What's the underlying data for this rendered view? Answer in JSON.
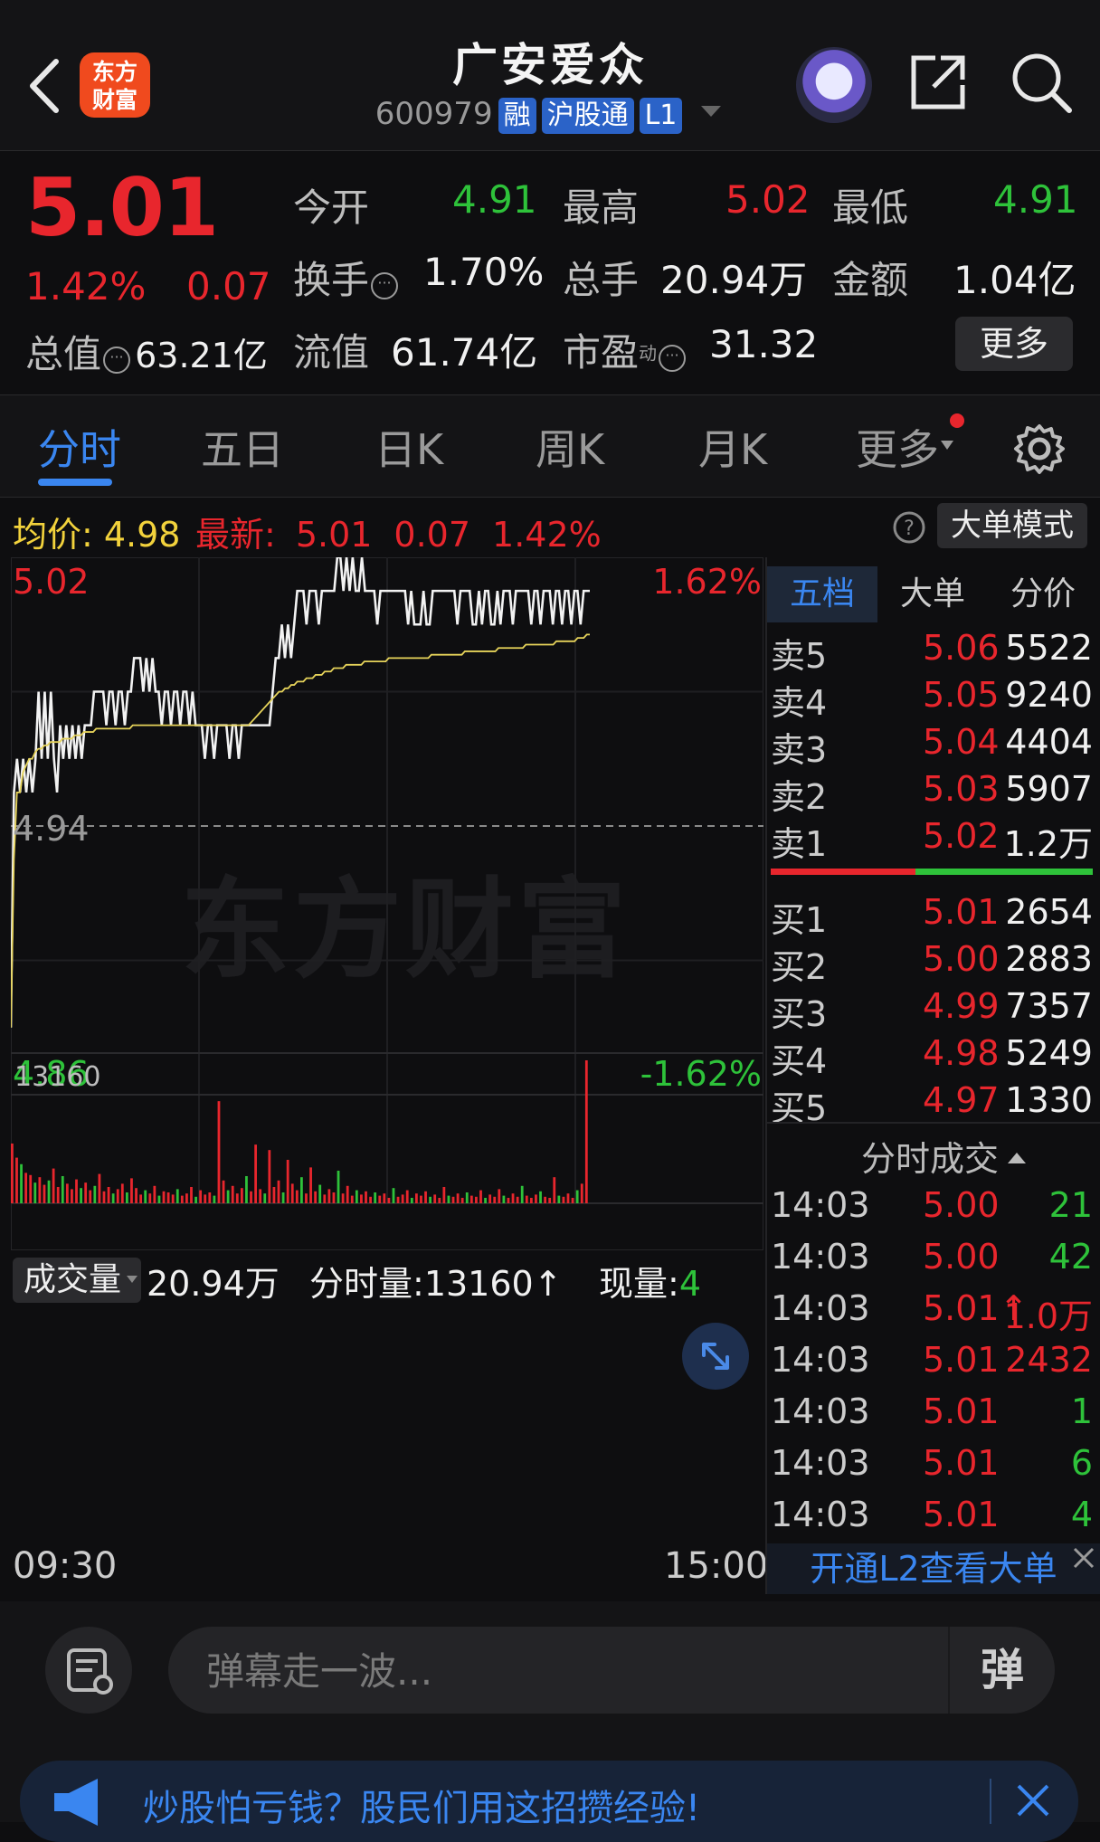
{
  "header": {
    "title": "广安爱众",
    "code": "600979",
    "tags": [
      "融",
      "沪股通",
      "L1"
    ],
    "logo_line1": "东方",
    "logo_line2": "财富"
  },
  "quote": {
    "price": "5.01",
    "change_pct": "1.42%",
    "change": "0.07",
    "total_value_label": "总值",
    "total_value": "63.21亿",
    "open_label": "今开",
    "open": "4.91",
    "high_label": "最高",
    "high": "5.02",
    "low_label": "最低",
    "low": "4.91",
    "turnover_label": "换手",
    "turnover": "1.70%",
    "volume_label": "总手",
    "volume": "20.94万",
    "amount_label": "金额",
    "amount": "1.04亿",
    "float_label": "流值",
    "float_value": "61.74亿",
    "pe_label": "市盈",
    "pe_sup": "动",
    "pe": "31.32",
    "more_label": "更多"
  },
  "tabs": [
    "分时",
    "五日",
    "日K",
    "周K",
    "月K",
    "更多"
  ],
  "info_bar": {
    "avg_label": "均价:",
    "avg": "4.98",
    "latest_label": "最新:",
    "latest": "5.01",
    "change": "0.07",
    "pct": "1.42%",
    "big_mode": "大单模式"
  },
  "chart_data": {
    "type": "line",
    "ylim": [
      4.86,
      5.02
    ],
    "y_left_labels": [
      "5.02",
      "4.94",
      "4.86"
    ],
    "y_right_labels": [
      "1.62%",
      "-1.62%"
    ],
    "x_labels": [
      "09:30",
      "15:00"
    ],
    "series": [
      {
        "values": [
          4.88,
          4.95,
          4.96,
          4.95,
          4.96,
          4.95,
          4.96,
          4.95,
          4.96,
          4.98,
          4.96,
          4.98,
          4.96,
          4.98,
          4.96,
          4.95,
          4.97,
          4.96,
          4.97,
          4.96,
          4.97,
          4.96,
          4.97,
          4.96,
          4.97,
          4.97,
          4.97,
          4.98,
          4.98,
          4.98,
          4.98,
          4.97,
          4.98,
          4.98,
          4.97,
          4.98,
          4.98,
          4.97,
          4.98,
          4.98,
          4.99,
          4.99,
          4.99,
          4.98,
          4.99,
          4.98,
          4.99,
          4.98,
          4.98,
          4.97,
          4.98,
          4.98,
          4.97,
          4.98,
          4.98,
          4.97,
          4.98,
          4.98,
          4.97,
          4.98,
          4.97,
          4.97,
          4.97,
          4.96,
          4.97,
          4.97,
          4.96,
          4.97,
          4.97,
          4.97,
          4.97,
          4.96,
          4.97,
          4.97,
          4.96,
          4.97,
          4.97,
          4.97,
          4.97,
          4.97,
          4.97,
          4.97,
          4.97,
          4.97,
          4.97,
          4.98,
          4.99,
          4.99,
          5.0,
          4.99,
          5.0,
          4.99,
          5.0,
          5.01,
          5.01,
          5.01,
          5.0,
          5.01,
          5.01,
          5.01,
          5.0,
          5.01,
          5.01,
          5.01,
          5.01,
          5.01,
          5.02,
          5.02,
          5.01,
          5.02,
          5.01,
          5.02,
          5.01,
          5.01,
          5.02,
          5.01,
          5.01,
          5.01,
          5.01,
          5.0,
          5.01,
          5.01,
          5.01,
          5.01,
          5.01,
          5.01,
          5.01,
          5.01,
          5.01,
          5.0,
          5.01,
          5.0,
          5.0,
          5.0,
          5.01,
          5.0,
          5.0,
          5.01,
          5.01,
          5.01,
          5.01,
          5.01,
          5.01,
          5.01,
          5.01,
          5.0,
          5.01,
          5.01,
          5.01,
          5.01,
          5.0,
          5.0,
          5.01,
          5.0,
          5.01,
          5.01,
          5.0,
          5.0,
          5.01,
          5.0,
          5.01,
          5.01,
          5.01,
          5.0,
          5.01,
          5.01,
          5.01,
          5.01,
          5.01,
          5.0,
          5.01,
          5.01,
          5.0,
          5.01,
          5.01,
          5.01,
          5.0,
          5.01,
          5.01,
          5.0,
          5.01,
          5.01,
          5.0,
          5.01,
          5.01,
          5.0,
          5.01,
          5.01,
          5.01
        ]
      },
      {
        "values": [
          4.88,
          4.93,
          4.95,
          4.95,
          4.956,
          4.958,
          4.96,
          4.96,
          4.962,
          4.963,
          4.963,
          4.964,
          4.964,
          4.965,
          4.965,
          4.965,
          4.965,
          4.966,
          4.966,
          4.966,
          4.966,
          4.967,
          4.967,
          4.967,
          4.968,
          4.968,
          4.968,
          4.968,
          4.969,
          4.969,
          4.969,
          4.969,
          4.969,
          4.969,
          4.969,
          4.969,
          4.969,
          4.969,
          4.969,
          4.969,
          4.97,
          4.97,
          4.97,
          4.97,
          4.97,
          4.97,
          4.97,
          4.97,
          4.97,
          4.97,
          4.97,
          4.97,
          4.97,
          4.97,
          4.97,
          4.97,
          4.97,
          4.97,
          4.97,
          4.97,
          4.97,
          4.97,
          4.97,
          4.97,
          4.97,
          4.97,
          4.97,
          4.97,
          4.97,
          4.97,
          4.97,
          4.97,
          4.97,
          4.97,
          4.97,
          4.97,
          4.97,
          4.97,
          4.97,
          4.971,
          4.972,
          4.973,
          4.974,
          4.975,
          4.976,
          4.977,
          4.978,
          4.979,
          4.98,
          4.98,
          4.981,
          4.981,
          4.982,
          4.982,
          4.983,
          4.983,
          4.983,
          4.984,
          4.984,
          4.984,
          4.985,
          4.985,
          4.985,
          4.986,
          4.986,
          4.986,
          4.987,
          4.987,
          4.987,
          4.987,
          4.988,
          4.988,
          4.988,
          4.988,
          4.988,
          4.988,
          4.989,
          4.989,
          4.989,
          4.989,
          4.989,
          4.989,
          4.989,
          4.989,
          4.99,
          4.99,
          4.99,
          4.99,
          4.99,
          4.99,
          4.99,
          4.99,
          4.99,
          4.99,
          4.99,
          4.99,
          4.99,
          4.99,
          4.991,
          4.991,
          4.991,
          4.991,
          4.991,
          4.991,
          4.991,
          4.991,
          4.991,
          4.991,
          4.991,
          4.992,
          4.992,
          4.992,
          4.992,
          4.992,
          4.992,
          4.992,
          4.992,
          4.992,
          4.992,
          4.992,
          4.993,
          4.993,
          4.993,
          4.993,
          4.993,
          4.993,
          4.993,
          4.993,
          4.993,
          4.994,
          4.994,
          4.994,
          4.994,
          4.994,
          4.994,
          4.994,
          4.994,
          4.994,
          4.994,
          4.995,
          4.995,
          4.995,
          4.995,
          4.995,
          4.995,
          4.995,
          4.996,
          4.996,
          4.996,
          4.997,
          4.997
        ]
      }
    ],
    "volume_max_label": "13160",
    "volume": [
      {
        "v": 5500,
        "c": "red"
      },
      {
        "v": 4200,
        "c": "red"
      },
      {
        "v": 3600,
        "c": "green"
      },
      {
        "v": 2800,
        "c": "red"
      },
      {
        "v": 2600,
        "c": "red"
      },
      {
        "v": 1900,
        "c": "green"
      },
      {
        "v": 2400,
        "c": "red"
      },
      {
        "v": 1700,
        "c": "red"
      },
      {
        "v": 2100,
        "c": "green"
      },
      {
        "v": 3200,
        "c": "red"
      },
      {
        "v": 1500,
        "c": "red"
      },
      {
        "v": 2500,
        "c": "green"
      },
      {
        "v": 1800,
        "c": "red"
      },
      {
        "v": 1300,
        "c": "red"
      },
      {
        "v": 2200,
        "c": "red"
      },
      {
        "v": 1400,
        "c": "green"
      },
      {
        "v": 1900,
        "c": "red"
      },
      {
        "v": 1200,
        "c": "red"
      },
      {
        "v": 1600,
        "c": "green"
      },
      {
        "v": 2700,
        "c": "red"
      },
      {
        "v": 1100,
        "c": "red"
      },
      {
        "v": 1500,
        "c": "red"
      },
      {
        "v": 900,
        "c": "green"
      },
      {
        "v": 1300,
        "c": "red"
      },
      {
        "v": 1800,
        "c": "red"
      },
      {
        "v": 1000,
        "c": "green"
      },
      {
        "v": 2300,
        "c": "red"
      },
      {
        "v": 1400,
        "c": "red"
      },
      {
        "v": 800,
        "c": "red"
      },
      {
        "v": 1200,
        "c": "green"
      },
      {
        "v": 900,
        "c": "red"
      },
      {
        "v": 1600,
        "c": "red"
      },
      {
        "v": 700,
        "c": "green"
      },
      {
        "v": 1100,
        "c": "red"
      },
      {
        "v": 1000,
        "c": "red"
      },
      {
        "v": 800,
        "c": "red"
      },
      {
        "v": 1300,
        "c": "green"
      },
      {
        "v": 700,
        "c": "red"
      },
      {
        "v": 900,
        "c": "red"
      },
      {
        "v": 1500,
        "c": "red"
      },
      {
        "v": 600,
        "c": "green"
      },
      {
        "v": 1200,
        "c": "red"
      },
      {
        "v": 800,
        "c": "red"
      },
      {
        "v": 1000,
        "c": "red"
      },
      {
        "v": 700,
        "c": "green"
      },
      {
        "v": 9400,
        "c": "red"
      },
      {
        "v": 2100,
        "c": "red"
      },
      {
        "v": 1200,
        "c": "green"
      },
      {
        "v": 1600,
        "c": "red"
      },
      {
        "v": 900,
        "c": "red"
      },
      {
        "v": 1400,
        "c": "red"
      },
      {
        "v": 2500,
        "c": "green"
      },
      {
        "v": 1100,
        "c": "red"
      },
      {
        "v": 5400,
        "c": "red"
      },
      {
        "v": 1300,
        "c": "red"
      },
      {
        "v": 900,
        "c": "green"
      },
      {
        "v": 4900,
        "c": "red"
      },
      {
        "v": 1500,
        "c": "red"
      },
      {
        "v": 2100,
        "c": "red"
      },
      {
        "v": 1000,
        "c": "green"
      },
      {
        "v": 4000,
        "c": "red"
      },
      {
        "v": 1800,
        "c": "red"
      },
      {
        "v": 1200,
        "c": "red"
      },
      {
        "v": 2400,
        "c": "green"
      },
      {
        "v": 900,
        "c": "red"
      },
      {
        "v": 3300,
        "c": "red"
      },
      {
        "v": 1100,
        "c": "red"
      },
      {
        "v": 1700,
        "c": "green"
      },
      {
        "v": 800,
        "c": "red"
      },
      {
        "v": 1300,
        "c": "red"
      },
      {
        "v": 1000,
        "c": "red"
      },
      {
        "v": 3000,
        "c": "green"
      },
      {
        "v": 900,
        "c": "red"
      },
      {
        "v": 1600,
        "c": "red"
      },
      {
        "v": 700,
        "c": "red"
      },
      {
        "v": 1200,
        "c": "green"
      },
      {
        "v": 800,
        "c": "red"
      },
      {
        "v": 1100,
        "c": "red"
      },
      {
        "v": 600,
        "c": "red"
      },
      {
        "v": 1000,
        "c": "green"
      },
      {
        "v": 700,
        "c": "red"
      },
      {
        "v": 900,
        "c": "red"
      },
      {
        "v": 500,
        "c": "red"
      },
      {
        "v": 1400,
        "c": "green"
      },
      {
        "v": 600,
        "c": "red"
      },
      {
        "v": 800,
        "c": "red"
      },
      {
        "v": 1200,
        "c": "red"
      },
      {
        "v": 500,
        "c": "green"
      },
      {
        "v": 900,
        "c": "red"
      },
      {
        "v": 700,
        "c": "red"
      },
      {
        "v": 1100,
        "c": "red"
      },
      {
        "v": 600,
        "c": "green"
      },
      {
        "v": 800,
        "c": "red"
      },
      {
        "v": 500,
        "c": "red"
      },
      {
        "v": 1500,
        "c": "red"
      },
      {
        "v": 700,
        "c": "green"
      },
      {
        "v": 600,
        "c": "red"
      },
      {
        "v": 900,
        "c": "red"
      },
      {
        "v": 500,
        "c": "red"
      },
      {
        "v": 1000,
        "c": "green"
      },
      {
        "v": 700,
        "c": "red"
      },
      {
        "v": 600,
        "c": "red"
      },
      {
        "v": 1200,
        "c": "red"
      },
      {
        "v": 500,
        "c": "green"
      },
      {
        "v": 800,
        "c": "red"
      },
      {
        "v": 600,
        "c": "red"
      },
      {
        "v": 1300,
        "c": "red"
      },
      {
        "v": 700,
        "c": "green"
      },
      {
        "v": 500,
        "c": "red"
      },
      {
        "v": 900,
        "c": "red"
      },
      {
        "v": 600,
        "c": "red"
      },
      {
        "v": 1600,
        "c": "green"
      },
      {
        "v": 700,
        "c": "red"
      },
      {
        "v": 500,
        "c": "red"
      },
      {
        "v": 800,
        "c": "red"
      },
      {
        "v": 1100,
        "c": "green"
      },
      {
        "v": 600,
        "c": "red"
      },
      {
        "v": 500,
        "c": "red"
      },
      {
        "v": 2400,
        "c": "red"
      },
      {
        "v": 700,
        "c": "green"
      },
      {
        "v": 600,
        "c": "red"
      },
      {
        "v": 900,
        "c": "red"
      },
      {
        "v": 500,
        "c": "red"
      },
      {
        "v": 1200,
        "c": "green"
      },
      {
        "v": 1800,
        "c": "red"
      },
      {
        "v": 13160,
        "c": "red"
      }
    ]
  },
  "volume_header": {
    "selector": "成交量",
    "total": "20.94万",
    "minute_label": "分时量:",
    "minute": "13160",
    "now_label": "现量:",
    "now": "4"
  },
  "orderbook": {
    "tabs": [
      "五档",
      "大单",
      "分价"
    ],
    "asks": [
      {
        "label": "卖5",
        "price": "5.06",
        "vol": "5522"
      },
      {
        "label": "卖4",
        "price": "5.05",
        "vol": "9240"
      },
      {
        "label": "卖3",
        "price": "5.04",
        "vol": "4404"
      },
      {
        "label": "卖2",
        "price": "5.03",
        "vol": "5907"
      },
      {
        "label": "卖1",
        "price": "5.02",
        "vol": "1.2万"
      }
    ],
    "bids": [
      {
        "label": "买1",
        "price": "5.01",
        "vol": "2654"
      },
      {
        "label": "买2",
        "price": "5.00",
        "vol": "2883"
      },
      {
        "label": "买3",
        "price": "4.99",
        "vol": "7357"
      },
      {
        "label": "买4",
        "price": "4.98",
        "vol": "5249"
      },
      {
        "label": "买5",
        "price": "4.97",
        "vol": "1330"
      }
    ],
    "ratio_red": 0.45
  },
  "ticks": {
    "title": "分时成交",
    "rows": [
      {
        "time": "14:03",
        "price": "5.00",
        "vol": "21",
        "color": "green"
      },
      {
        "time": "14:03",
        "price": "5.00",
        "vol": "42",
        "color": "green"
      },
      {
        "time": "14:03",
        "price": "5.01↑",
        "vol": "1.0万",
        "color": "red"
      },
      {
        "time": "14:03",
        "price": "5.01",
        "vol": "2432",
        "color": "red"
      },
      {
        "time": "14:03",
        "price": "5.01",
        "vol": "1",
        "color": "green"
      },
      {
        "time": "14:03",
        "price": "5.01",
        "vol": "6",
        "color": "green"
      },
      {
        "time": "14:03",
        "price": "5.01",
        "vol": "4",
        "color": "green"
      }
    ],
    "l2_link": "开通L2查看大单"
  },
  "bottom": {
    "danmu_placeholder": "弹幕走一波...",
    "danmu_button": "弹",
    "banner_text": "炒股怕亏钱？股民们用这招攒经验!"
  },
  "watermark": "东方财富"
}
